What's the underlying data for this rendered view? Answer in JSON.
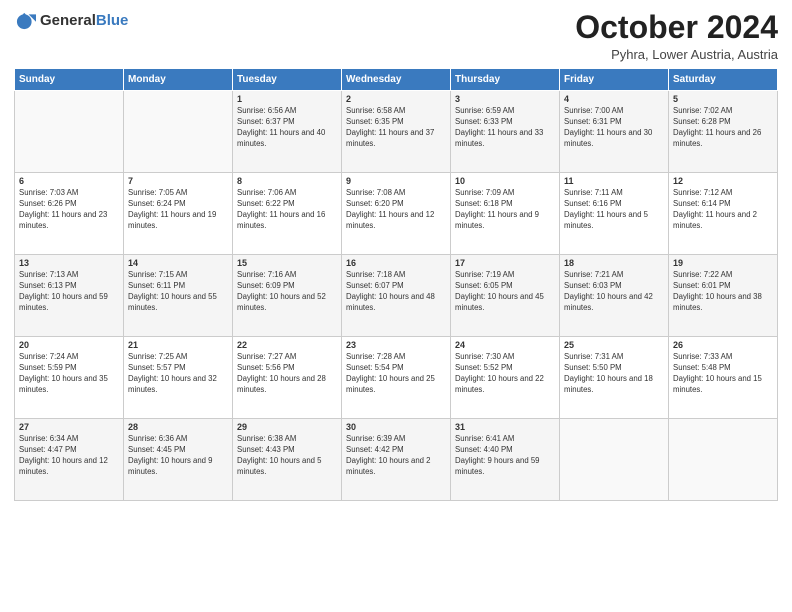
{
  "header": {
    "logo": {
      "general": "General",
      "blue": "Blue"
    },
    "month": "October 2024",
    "location": "Pyhra, Lower Austria, Austria"
  },
  "weekdays": [
    "Sunday",
    "Monday",
    "Tuesday",
    "Wednesday",
    "Thursday",
    "Friday",
    "Saturday"
  ],
  "weeks": [
    [
      {
        "day": "",
        "sunrise": "",
        "sunset": "",
        "daylight": ""
      },
      {
        "day": "",
        "sunrise": "",
        "sunset": "",
        "daylight": ""
      },
      {
        "day": "1",
        "sunrise": "Sunrise: 6:56 AM",
        "sunset": "Sunset: 6:37 PM",
        "daylight": "Daylight: 11 hours and 40 minutes."
      },
      {
        "day": "2",
        "sunrise": "Sunrise: 6:58 AM",
        "sunset": "Sunset: 6:35 PM",
        "daylight": "Daylight: 11 hours and 37 minutes."
      },
      {
        "day": "3",
        "sunrise": "Sunrise: 6:59 AM",
        "sunset": "Sunset: 6:33 PM",
        "daylight": "Daylight: 11 hours and 33 minutes."
      },
      {
        "day": "4",
        "sunrise": "Sunrise: 7:00 AM",
        "sunset": "Sunset: 6:31 PM",
        "daylight": "Daylight: 11 hours and 30 minutes."
      },
      {
        "day": "5",
        "sunrise": "Sunrise: 7:02 AM",
        "sunset": "Sunset: 6:28 PM",
        "daylight": "Daylight: 11 hours and 26 minutes."
      }
    ],
    [
      {
        "day": "6",
        "sunrise": "Sunrise: 7:03 AM",
        "sunset": "Sunset: 6:26 PM",
        "daylight": "Daylight: 11 hours and 23 minutes."
      },
      {
        "day": "7",
        "sunrise": "Sunrise: 7:05 AM",
        "sunset": "Sunset: 6:24 PM",
        "daylight": "Daylight: 11 hours and 19 minutes."
      },
      {
        "day": "8",
        "sunrise": "Sunrise: 7:06 AM",
        "sunset": "Sunset: 6:22 PM",
        "daylight": "Daylight: 11 hours and 16 minutes."
      },
      {
        "day": "9",
        "sunrise": "Sunrise: 7:08 AM",
        "sunset": "Sunset: 6:20 PM",
        "daylight": "Daylight: 11 hours and 12 minutes."
      },
      {
        "day": "10",
        "sunrise": "Sunrise: 7:09 AM",
        "sunset": "Sunset: 6:18 PM",
        "daylight": "Daylight: 11 hours and 9 minutes."
      },
      {
        "day": "11",
        "sunrise": "Sunrise: 7:11 AM",
        "sunset": "Sunset: 6:16 PM",
        "daylight": "Daylight: 11 hours and 5 minutes."
      },
      {
        "day": "12",
        "sunrise": "Sunrise: 7:12 AM",
        "sunset": "Sunset: 6:14 PM",
        "daylight": "Daylight: 11 hours and 2 minutes."
      }
    ],
    [
      {
        "day": "13",
        "sunrise": "Sunrise: 7:13 AM",
        "sunset": "Sunset: 6:13 PM",
        "daylight": "Daylight: 10 hours and 59 minutes."
      },
      {
        "day": "14",
        "sunrise": "Sunrise: 7:15 AM",
        "sunset": "Sunset: 6:11 PM",
        "daylight": "Daylight: 10 hours and 55 minutes."
      },
      {
        "day": "15",
        "sunrise": "Sunrise: 7:16 AM",
        "sunset": "Sunset: 6:09 PM",
        "daylight": "Daylight: 10 hours and 52 minutes."
      },
      {
        "day": "16",
        "sunrise": "Sunrise: 7:18 AM",
        "sunset": "Sunset: 6:07 PM",
        "daylight": "Daylight: 10 hours and 48 minutes."
      },
      {
        "day": "17",
        "sunrise": "Sunrise: 7:19 AM",
        "sunset": "Sunset: 6:05 PM",
        "daylight": "Daylight: 10 hours and 45 minutes."
      },
      {
        "day": "18",
        "sunrise": "Sunrise: 7:21 AM",
        "sunset": "Sunset: 6:03 PM",
        "daylight": "Daylight: 10 hours and 42 minutes."
      },
      {
        "day": "19",
        "sunrise": "Sunrise: 7:22 AM",
        "sunset": "Sunset: 6:01 PM",
        "daylight": "Daylight: 10 hours and 38 minutes."
      }
    ],
    [
      {
        "day": "20",
        "sunrise": "Sunrise: 7:24 AM",
        "sunset": "Sunset: 5:59 PM",
        "daylight": "Daylight: 10 hours and 35 minutes."
      },
      {
        "day": "21",
        "sunrise": "Sunrise: 7:25 AM",
        "sunset": "Sunset: 5:57 PM",
        "daylight": "Daylight: 10 hours and 32 minutes."
      },
      {
        "day": "22",
        "sunrise": "Sunrise: 7:27 AM",
        "sunset": "Sunset: 5:56 PM",
        "daylight": "Daylight: 10 hours and 28 minutes."
      },
      {
        "day": "23",
        "sunrise": "Sunrise: 7:28 AM",
        "sunset": "Sunset: 5:54 PM",
        "daylight": "Daylight: 10 hours and 25 minutes."
      },
      {
        "day": "24",
        "sunrise": "Sunrise: 7:30 AM",
        "sunset": "Sunset: 5:52 PM",
        "daylight": "Daylight: 10 hours and 22 minutes."
      },
      {
        "day": "25",
        "sunrise": "Sunrise: 7:31 AM",
        "sunset": "Sunset: 5:50 PM",
        "daylight": "Daylight: 10 hours and 18 minutes."
      },
      {
        "day": "26",
        "sunrise": "Sunrise: 7:33 AM",
        "sunset": "Sunset: 5:48 PM",
        "daylight": "Daylight: 10 hours and 15 minutes."
      }
    ],
    [
      {
        "day": "27",
        "sunrise": "Sunrise: 6:34 AM",
        "sunset": "Sunset: 4:47 PM",
        "daylight": "Daylight: 10 hours and 12 minutes."
      },
      {
        "day": "28",
        "sunrise": "Sunrise: 6:36 AM",
        "sunset": "Sunset: 4:45 PM",
        "daylight": "Daylight: 10 hours and 9 minutes."
      },
      {
        "day": "29",
        "sunrise": "Sunrise: 6:38 AM",
        "sunset": "Sunset: 4:43 PM",
        "daylight": "Daylight: 10 hours and 5 minutes."
      },
      {
        "day": "30",
        "sunrise": "Sunrise: 6:39 AM",
        "sunset": "Sunset: 4:42 PM",
        "daylight": "Daylight: 10 hours and 2 minutes."
      },
      {
        "day": "31",
        "sunrise": "Sunrise: 6:41 AM",
        "sunset": "Sunset: 4:40 PM",
        "daylight": "Daylight: 9 hours and 59 minutes."
      },
      {
        "day": "",
        "sunrise": "",
        "sunset": "",
        "daylight": ""
      },
      {
        "day": "",
        "sunrise": "",
        "sunset": "",
        "daylight": ""
      }
    ]
  ]
}
